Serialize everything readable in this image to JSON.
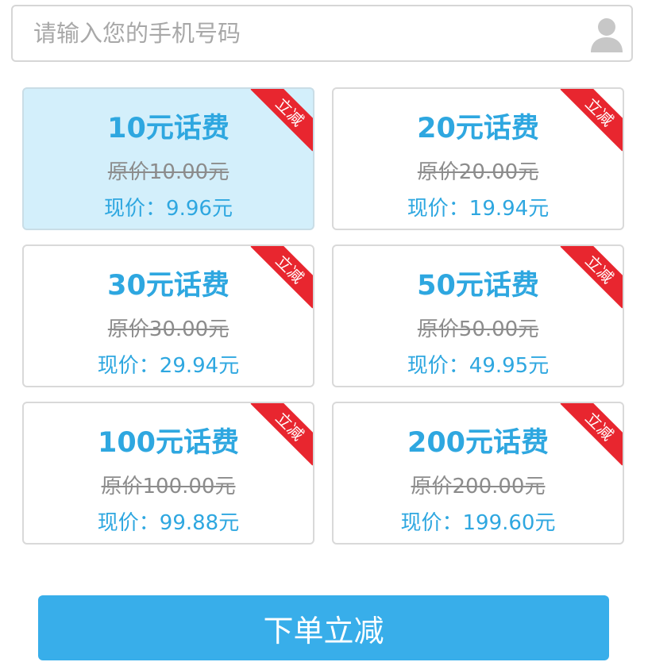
{
  "phone": {
    "placeholder": "请输入您的手机号码",
    "value": ""
  },
  "icons": {
    "user": "user-icon"
  },
  "colors": {
    "accent": "#2ea7e0",
    "selected_bg": "#d3effb",
    "ribbon": "#e8262f",
    "button": "#38aeea",
    "strike_text": "#8c8c8c"
  },
  "packages": [
    {
      "title": "10元话费",
      "original": "原价10.00元",
      "current": "现价：9.96元",
      "badge": "立减",
      "selected": true
    },
    {
      "title": "20元话费",
      "original": "原价20.00元",
      "current": "现价：19.94元",
      "badge": "立减",
      "selected": false
    },
    {
      "title": "30元话费",
      "original": "原价30.00元",
      "current": "现价：29.94元",
      "badge": "立减",
      "selected": false
    },
    {
      "title": "50元话费",
      "original": "原价50.00元",
      "current": "现价：49.95元",
      "badge": "立减",
      "selected": false
    },
    {
      "title": "100元话费",
      "original": "原价100.00元",
      "current": "现价：99.88元",
      "badge": "立减",
      "selected": false
    },
    {
      "title": "200元话费",
      "original": "原价200.00元",
      "current": "现价：199.60元",
      "badge": "立减",
      "selected": false
    }
  ],
  "order_button": {
    "label": "下单立减"
  }
}
